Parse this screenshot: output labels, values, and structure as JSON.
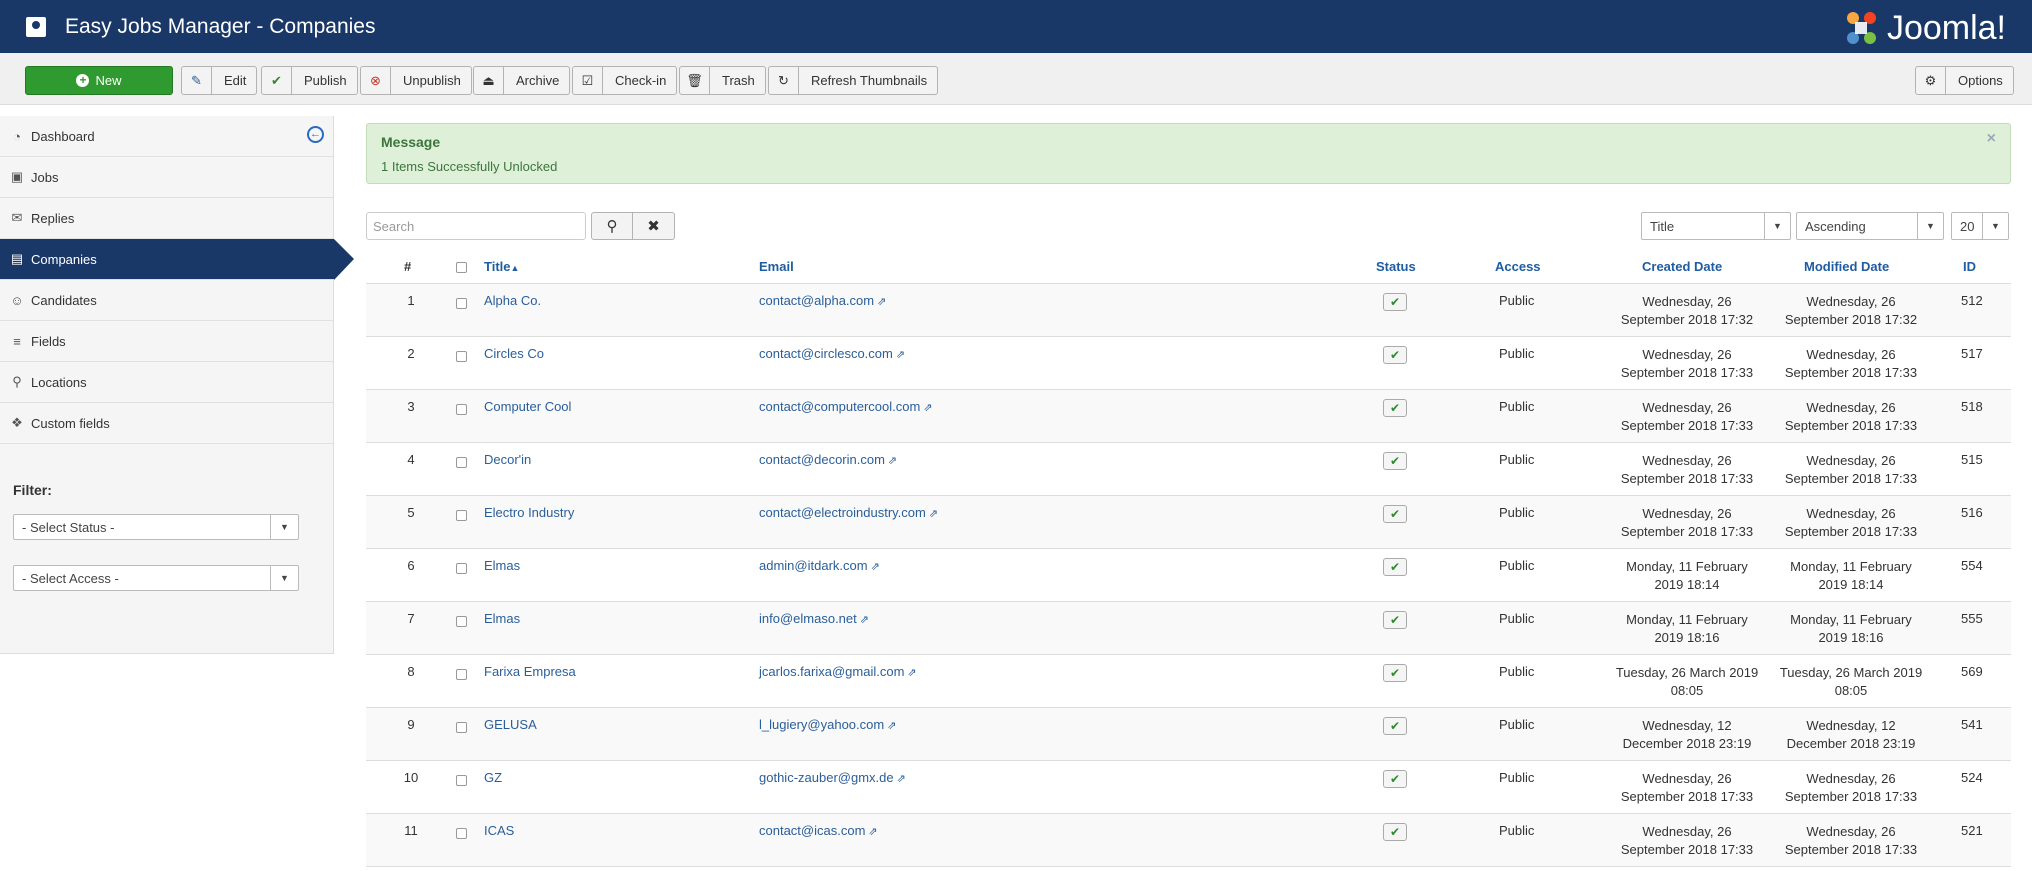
{
  "header": {
    "title": "Easy Jobs Manager - Companies",
    "logo_text": "Joomla!"
  },
  "toolbar": {
    "new": "New",
    "edit": "Edit",
    "publish": "Publish",
    "unpublish": "Unpublish",
    "archive": "Archive",
    "checkin": "Check-in",
    "trash": "Trash",
    "refresh": "Refresh Thumbnails",
    "options": "Options"
  },
  "sidebar": {
    "items": [
      {
        "label": "Dashboard",
        "icon": "dashboard-icon"
      },
      {
        "label": "Jobs",
        "icon": "briefcase-icon"
      },
      {
        "label": "Replies",
        "icon": "envelope-icon"
      },
      {
        "label": "Companies",
        "icon": "building-icon"
      },
      {
        "label": "Candidates",
        "icon": "users-icon"
      },
      {
        "label": "Fields",
        "icon": "list-icon"
      },
      {
        "label": "Locations",
        "icon": "map-marker-icon"
      },
      {
        "label": "Custom fields",
        "icon": "cubes-icon"
      }
    ],
    "filter_label": "Filter:",
    "select_status": "- Select Status -",
    "select_access": "- Select Access -"
  },
  "message": {
    "title": "Message",
    "text": "1 Items Successfully Unlocked",
    "close": "×"
  },
  "search": {
    "placeholder": "Search"
  },
  "list_controls": {
    "ordering": "Title",
    "direction": "Ascending",
    "limit": "20"
  },
  "table": {
    "headers": {
      "num": "#",
      "title": "Title",
      "email": "Email",
      "status": "Status",
      "access": "Access",
      "created": "Created Date",
      "modified": "Modified Date",
      "id": "ID"
    },
    "rows": [
      {
        "num": "1",
        "title": "Alpha Co.",
        "email": "contact@alpha.com",
        "access": "Public",
        "created1": "Wednesday, 26",
        "created2": "September 2018 17:32",
        "modified1": "Wednesday, 26",
        "modified2": "September 2018 17:32",
        "id": "512"
      },
      {
        "num": "2",
        "title": "Circles Co",
        "email": "contact@circlesco.com",
        "access": "Public",
        "created1": "Wednesday, 26",
        "created2": "September 2018 17:33",
        "modified1": "Wednesday, 26",
        "modified2": "September 2018 17:33",
        "id": "517"
      },
      {
        "num": "3",
        "title": "Computer Cool",
        "email": "contact@computercool.com",
        "access": "Public",
        "created1": "Wednesday, 26",
        "created2": "September 2018 17:33",
        "modified1": "Wednesday, 26",
        "modified2": "September 2018 17:33",
        "id": "518"
      },
      {
        "num": "4",
        "title": "Decor'in",
        "email": "contact@decorin.com",
        "access": "Public",
        "created1": "Wednesday, 26",
        "created2": "September 2018 17:33",
        "modified1": "Wednesday, 26",
        "modified2": "September 2018 17:33",
        "id": "515"
      },
      {
        "num": "5",
        "title": "Electro Industry",
        "email": "contact@electroindustry.com",
        "access": "Public",
        "created1": "Wednesday, 26",
        "created2": "September 2018 17:33",
        "modified1": "Wednesday, 26",
        "modified2": "September 2018 17:33",
        "id": "516"
      },
      {
        "num": "6",
        "title": "Elmas",
        "email": "admin@itdark.com",
        "access": "Public",
        "created1": "Monday, 11 February",
        "created2": "2019 18:14",
        "modified1": "Monday, 11 February",
        "modified2": "2019 18:14",
        "id": "554"
      },
      {
        "num": "7",
        "title": "Elmas",
        "email": "info@elmaso.net",
        "access": "Public",
        "created1": "Monday, 11 February",
        "created2": "2019 18:16",
        "modified1": "Monday, 11 February",
        "modified2": "2019 18:16",
        "id": "555"
      },
      {
        "num": "8",
        "title": "Farixa Empresa",
        "email": "jcarlos.farixa@gmail.com",
        "access": "Public",
        "created1": "Tuesday, 26 March 2019",
        "created2": "08:05",
        "modified1": "Tuesday, 26 March 2019",
        "modified2": "08:05",
        "id": "569"
      },
      {
        "num": "9",
        "title": "GELUSA",
        "email": "l_lugiery@yahoo.com",
        "access": "Public",
        "created1": "Wednesday, 12",
        "created2": "December 2018 23:19",
        "modified1": "Wednesday, 12",
        "modified2": "December 2018 23:19",
        "id": "541"
      },
      {
        "num": "10",
        "title": "GZ",
        "email": "gothic-zauber@gmx.de",
        "access": "Public",
        "created1": "Wednesday, 26",
        "created2": "September 2018 17:33",
        "modified1": "Wednesday, 26",
        "modified2": "September 2018 17:33",
        "id": "524"
      },
      {
        "num": "11",
        "title": "ICAS",
        "email": "contact@icas.com",
        "access": "Public",
        "created1": "Wednesday, 26",
        "created2": "September 2018 17:33",
        "modified1": "Wednesday, 26",
        "modified2": "September 2018 17:33",
        "id": "521"
      }
    ]
  }
}
